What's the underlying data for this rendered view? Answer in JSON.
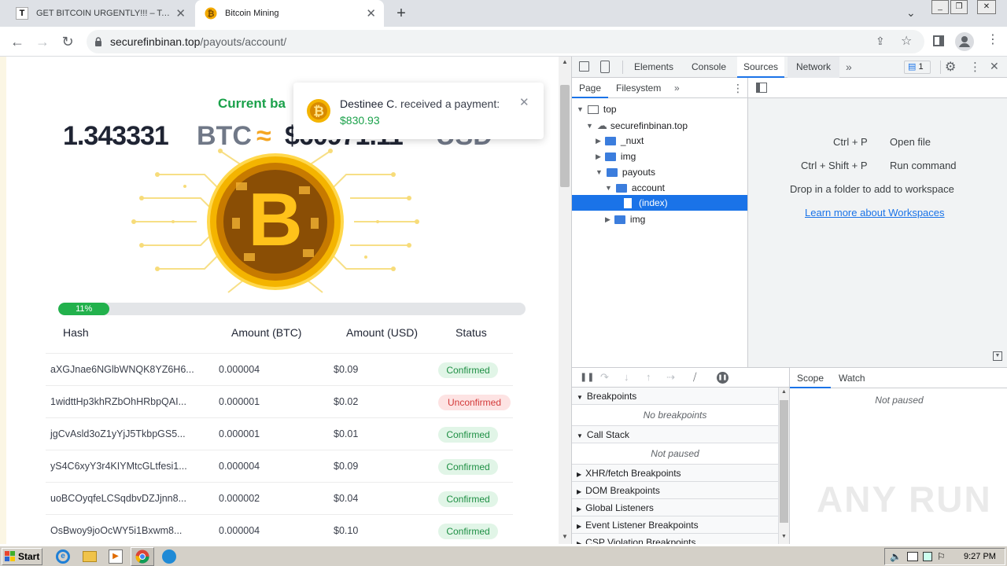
{
  "browser": {
    "tabs": [
      {
        "favicon": "T",
        "title": "GET BITCOIN URGENTLY!!! – Telegra"
      },
      {
        "favicon": "bitcoin-icon",
        "title": "Bitcoin Mining"
      }
    ],
    "url_host": "securefinbinan.top",
    "url_path": "/payouts/account/"
  },
  "page": {
    "balance_title": "Current ba",
    "balance_btc": "1.343331",
    "btc_unit": "BTC",
    "approx_symbol": "≈",
    "balance_usd": "$60971.11",
    "usd_unit": "USD",
    "progress_label": "11%",
    "progress_value": 0.11,
    "notification": {
      "name": "Destinee C.",
      "text": "received a payment:",
      "amount": "$830.93"
    },
    "table": {
      "headers": [
        "Hash",
        "Amount (BTC)",
        "Amount (USD)",
        "Status"
      ],
      "rows": [
        {
          "hash": "aXGJnae6NGlbWNQK8YZ6H6...",
          "btc": "0.000004",
          "usd": "$0.09",
          "status": "Confirmed"
        },
        {
          "hash": "1widttHp3khRZbOhHRbpQAI...",
          "btc": "0.000001",
          "usd": "$0.02",
          "status": "Unconfirmed"
        },
        {
          "hash": "jgCvAsld3oZ1yYjJ5TkbpGS5...",
          "btc": "0.000001",
          "usd": "$0.01",
          "status": "Confirmed"
        },
        {
          "hash": "yS4C6xyY3r4KIYMtcGLtfesi1...",
          "btc": "0.000004",
          "usd": "$0.09",
          "status": "Confirmed"
        },
        {
          "hash": "uoBCOyqfeLCSqdbvDZJjnn8...",
          "btc": "0.000002",
          "usd": "$0.04",
          "status": "Confirmed"
        },
        {
          "hash": "OsBwoy9joOcWY5i1Bxwm8...",
          "btc": "0.000004",
          "usd": "$0.10",
          "status": "Confirmed"
        }
      ]
    }
  },
  "devtools": {
    "tabs": [
      "Elements",
      "Console",
      "Sources",
      "Network"
    ],
    "active_tab": "Sources",
    "issues_count": "1",
    "subtabs": [
      "Page",
      "Filesystem"
    ],
    "tree": {
      "top": "top",
      "domain": "securefinbinan.top",
      "nuxt": "_nuxt",
      "img": "img",
      "payouts": "payouts",
      "account": "account",
      "index": "(index)",
      "img2": "img"
    },
    "shortcuts": [
      {
        "keys": "Ctrl + P",
        "action": "Open file"
      },
      {
        "keys": "Ctrl + Shift + P",
        "action": "Run command"
      }
    ],
    "drop_text": "Drop in a folder to add to workspace",
    "learn_link": "Learn more about Workspaces",
    "right_tabs": [
      "Scope",
      "Watch"
    ],
    "not_paused": "Not paused",
    "sections": {
      "breakpoints": "Breakpoints",
      "no_breakpoints": "No breakpoints",
      "call_stack": "Call Stack",
      "call_stack_body": "Not paused",
      "xhr": "XHR/fetch Breakpoints",
      "dom": "DOM Breakpoints",
      "global": "Global Listeners",
      "event": "Event Listener Breakpoints",
      "csp": "CSP Violation Breakpoints"
    }
  },
  "taskbar": {
    "start": "Start",
    "time": "9:27 PM"
  },
  "watermark": "ANY RUN",
  "colors": {
    "green": "#1aa14a",
    "progress": "#22b14c",
    "devtools_blue": "#1a73e8"
  }
}
